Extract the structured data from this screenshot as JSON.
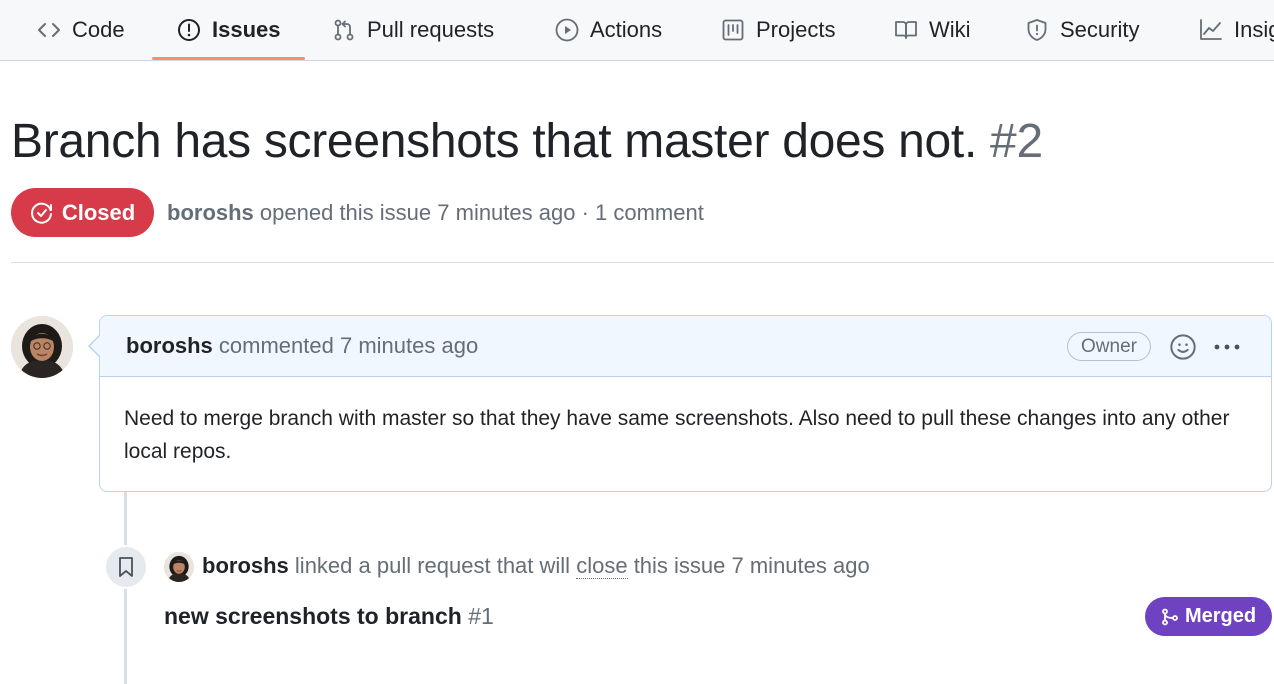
{
  "nav": {
    "tabs": [
      {
        "label": "Code",
        "icon": "code-icon"
      },
      {
        "label": "Issues",
        "icon": "issue-icon",
        "active": true
      },
      {
        "label": "Pull requests",
        "icon": "pull-request-icon"
      },
      {
        "label": "Actions",
        "icon": "play-icon"
      },
      {
        "label": "Projects",
        "icon": "project-icon"
      },
      {
        "label": "Wiki",
        "icon": "book-icon"
      },
      {
        "label": "Security",
        "icon": "shield-icon"
      },
      {
        "label": "Insights",
        "icon": "graph-icon"
      }
    ],
    "active_color": "#fd8c73"
  },
  "issue": {
    "title": "Branch has screenshots that master does not.",
    "number": "#2",
    "state": "Closed",
    "state_color": "#d73a49",
    "author": "boroshs",
    "opened_text": "opened this issue 7 minutes ago · 1 comment"
  },
  "comment": {
    "author": "boroshs",
    "action_text": "commented 7 minutes ago",
    "role_badge": "Owner",
    "body": "Need to merge branch with master so that they have same screenshots. Also need to pull these changes into any other local repos."
  },
  "event": {
    "author": "boroshs",
    "text_before": "linked a pull request that will",
    "dotted_word": "close",
    "text_after": "this issue 7 minutes ago",
    "pr_title": "new screenshots to branch",
    "pr_number": "#1",
    "pr_state": "Merged",
    "pr_state_color": "#6f42c1"
  }
}
